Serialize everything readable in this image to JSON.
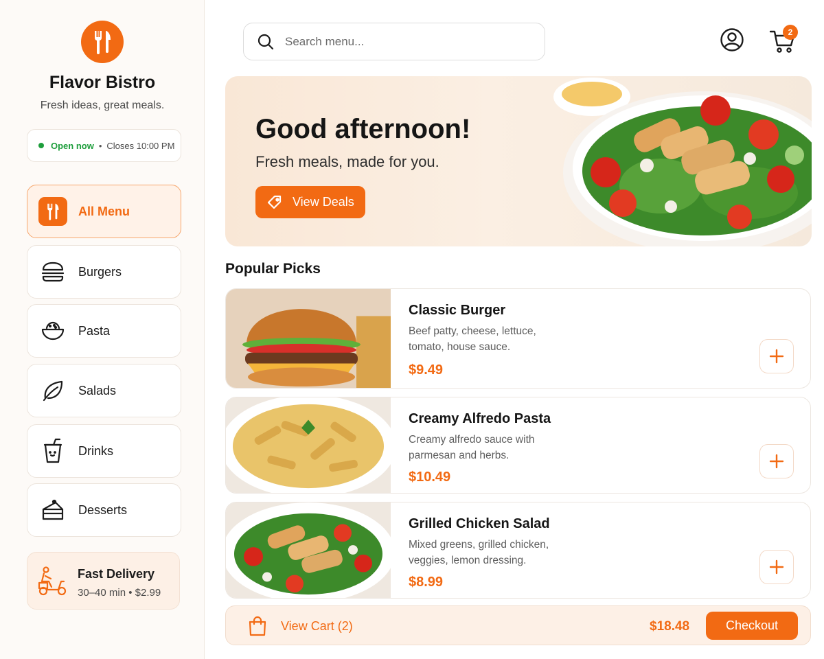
{
  "brand": {
    "name": "Flavor Bistro",
    "tagline": "Fresh ideas, great meals.",
    "logo_icon": "fork-knife-icon",
    "accent_color": "#f26a13"
  },
  "status": {
    "open_label": "Open now",
    "separator": "•",
    "closes_label": "Closes 10:00 PM",
    "status_color": "#1e9e3c"
  },
  "sidebar": {
    "items": [
      {
        "label": "All Menu",
        "icon": "fork-knife-icon",
        "active": true
      },
      {
        "label": "Burgers",
        "icon": "burger-icon",
        "active": false
      },
      {
        "label": "Pasta",
        "icon": "bowl-icon",
        "active": false
      },
      {
        "label": "Salads",
        "icon": "leaf-icon",
        "active": false
      },
      {
        "label": "Drinks",
        "icon": "cup-icon",
        "active": false
      },
      {
        "label": "Desserts",
        "icon": "cake-icon",
        "active": false
      }
    ]
  },
  "delivery": {
    "title": "Fast Delivery",
    "subtitle": "30–40 min • $2.99",
    "icon": "scooter-icon"
  },
  "header": {
    "search_placeholder": "Search menu...",
    "cart_count": "2",
    "user_icon": "user-icon",
    "cart_icon": "cart-icon"
  },
  "hero": {
    "title": "Good afternoon!",
    "subtitle": "Fresh meals, made for you.",
    "button_label": "View Deals",
    "button_icon": "tag-icon"
  },
  "popular": {
    "title": "Popular Picks",
    "items": [
      {
        "name": "Classic Burger",
        "description": "Beef patty, cheese, lettuce, tomato, house sauce.",
        "price": "$9.49"
      },
      {
        "name": "Creamy Alfredo Pasta",
        "description": "Creamy alfredo sauce with parmesan and herbs.",
        "price": "$10.49"
      },
      {
        "name": "Grilled Chicken Salad",
        "description": "Mixed greens, grilled chicken, veggies, lemon dressing.",
        "price": "$8.99"
      }
    ]
  },
  "cart_bar": {
    "label": "View Cart (2)",
    "total": "$18.48",
    "checkout_label": "Checkout",
    "icon": "shopping-bag-icon"
  }
}
